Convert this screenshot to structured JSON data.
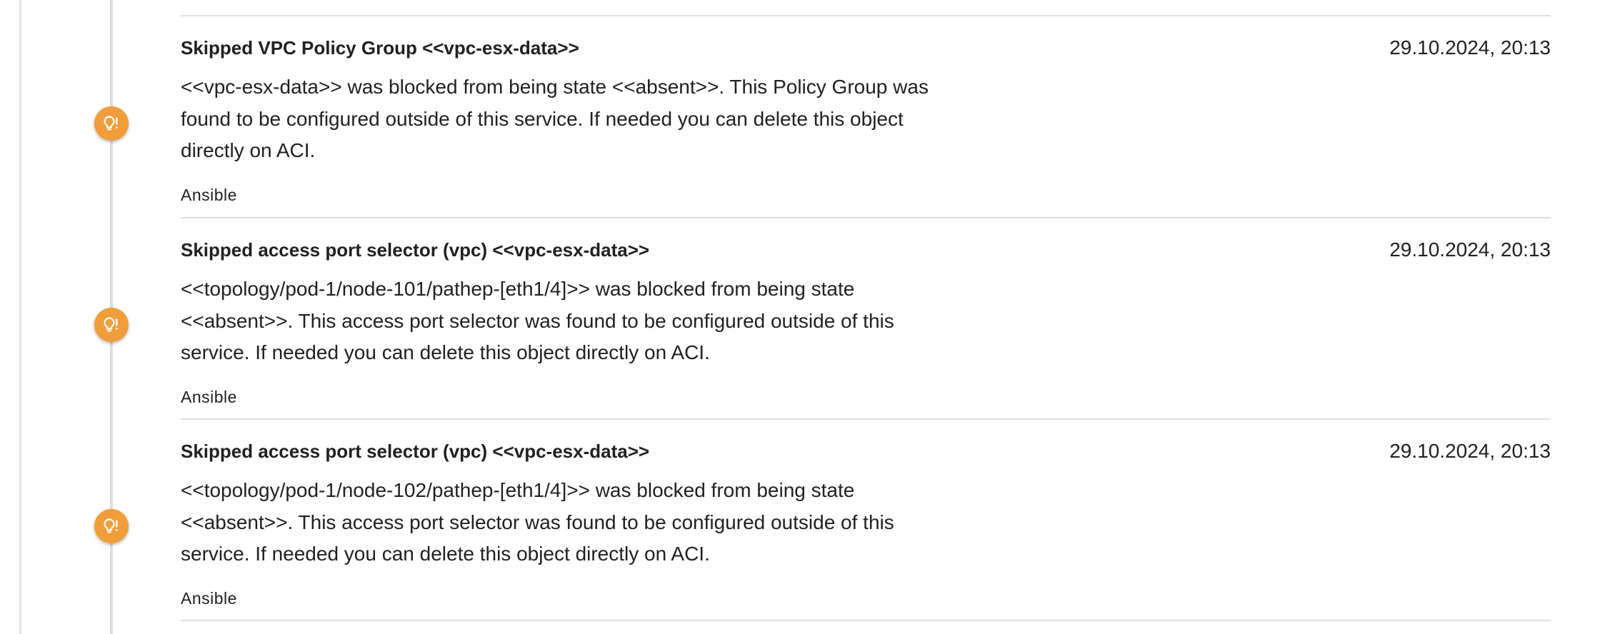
{
  "colors": {
    "accent": "#f09e3b",
    "timeline": "#dedede",
    "divider": "#e0e0e0",
    "text": "#212121"
  },
  "entries": [
    {
      "icon": "lightbulb-alert-icon",
      "title": "Skipped VPC Policy Group <<vpc-esx-data>>",
      "timestamp": "29.10.2024, 20:13",
      "message": "<<vpc-esx-data>> was blocked from being state <<absent>>. This Policy Group was found to be configured outside of this service. If needed you can delete this object directly on ACI.",
      "source": "Ansible"
    },
    {
      "icon": "lightbulb-alert-icon",
      "title": "Skipped access port selector (vpc) <<vpc-esx-data>>",
      "timestamp": "29.10.2024, 20:13",
      "message": "<<topology/pod-1/node-101/pathep-[eth1/4]>> was blocked from being state <<absent>>. This access port selector was found to be configured outside of this service. If needed you can delete this object directly on ACI.",
      "source": "Ansible"
    },
    {
      "icon": "lightbulb-alert-icon",
      "title": "Skipped access port selector (vpc) <<vpc-esx-data>>",
      "timestamp": "29.10.2024, 20:13",
      "message": "<<topology/pod-1/node-102/pathep-[eth1/4]>> was blocked from being state <<absent>>. This access port selector was found to be configured outside of this service. If needed you can delete this object directly on ACI.",
      "source": "Ansible"
    }
  ]
}
